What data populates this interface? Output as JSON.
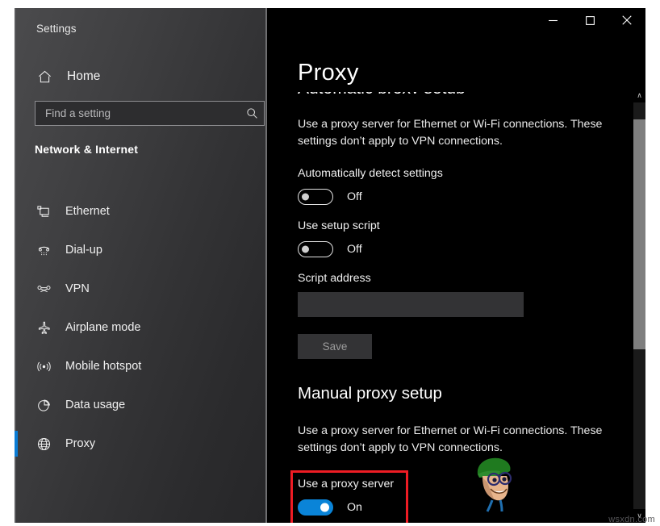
{
  "window": {
    "app_title": "Settings",
    "controls": [
      {
        "name": "minimize",
        "glyph": "─"
      },
      {
        "name": "maximize",
        "glyph": "□"
      },
      {
        "name": "close",
        "glyph": "✕"
      }
    ]
  },
  "sidebar": {
    "home_label": "Home",
    "search": {
      "placeholder": "Find a setting",
      "value": "",
      "icon": "search-icon"
    },
    "category": "Network & Internet",
    "items": [
      {
        "label": "Ethernet",
        "icon": "ethernet-icon",
        "selected": false
      },
      {
        "label": "Dial-up",
        "icon": "dialup-phone-icon",
        "selected": false
      },
      {
        "label": "VPN",
        "icon": "vpn-icon",
        "selected": false
      },
      {
        "label": "Airplane mode",
        "icon": "airplane-icon",
        "selected": false
      },
      {
        "label": "Mobile hotspot",
        "icon": "hotspot-signal-icon",
        "selected": false
      },
      {
        "label": "Data usage",
        "icon": "pie-chart-icon",
        "selected": false
      },
      {
        "label": "Proxy",
        "icon": "globe-icon",
        "selected": true
      }
    ]
  },
  "main": {
    "page_title": "Proxy",
    "ghost_heading": "Automatic proxy setup",
    "automatic": {
      "description": "Use a proxy server for Ethernet or Wi-Fi connections. These settings don’t apply to VPN connections.",
      "auto_detect_label": "Automatically detect settings",
      "auto_detect_state": "Off",
      "setup_script_label": "Use setup script",
      "setup_script_state": "Off",
      "script_address_label": "Script address",
      "script_address_value": "",
      "save_label": "Save"
    },
    "manual": {
      "heading": "Manual proxy setup",
      "description": "Use a proxy server for Ethernet or Wi-Fi connections. These settings don’t apply to VPN connections.",
      "use_proxy_label": "Use a proxy server",
      "use_proxy_state": "On"
    }
  },
  "scrollbar": {
    "up_glyph": "∧",
    "down_glyph": "∨"
  },
  "watermark": "wsxdn.com",
  "colors": {
    "accent_blue": "#0a7cd4",
    "toggle_on": "#0a84d8",
    "highlight_red": "#ee1c24",
    "content_bg": "#000000",
    "field_bg": "#333335"
  }
}
